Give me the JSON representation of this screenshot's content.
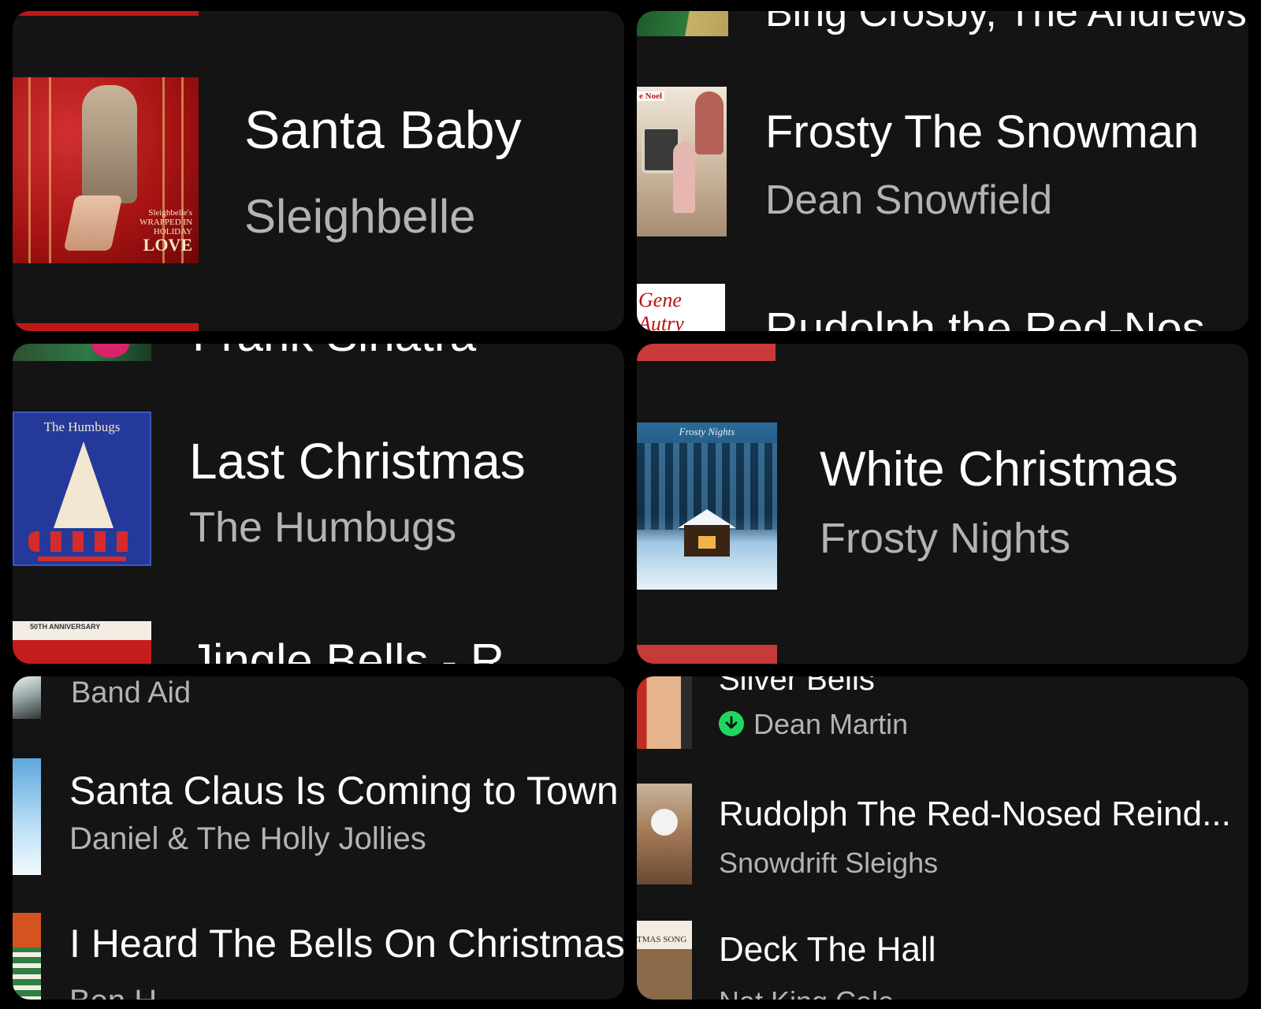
{
  "panel1": {
    "title": "Santa Baby",
    "artist": "Sleighbelle",
    "album_caption_small": "Sleighbelle's",
    "album_caption_line1": "WRAPPED IN",
    "album_caption_line2": "HOLIDAY",
    "album_caption_big": "LOVE"
  },
  "panel2": {
    "prev_artist": "Bing Crosby, The Andrews",
    "title": "Frosty The Snowman",
    "artist": "Dean Snowfield",
    "art_label": "e Noel",
    "next_art_label": "Gene Autry",
    "next_title": "Rudolph the Red-Nos"
  },
  "panel3": {
    "prev_artist": "Frank Sinatra",
    "title": "Last Christmas",
    "artist": "The Humbugs",
    "art_label": "The Humbugs",
    "next_art_label": "50TH ANNIVERSARY",
    "next_title": "Jingle Bells - R"
  },
  "panel4": {
    "title": "White Christmas",
    "artist": "Frosty Nights",
    "art_label": "Frosty Nights"
  },
  "panel5": {
    "prev_artist": "Band Aid",
    "title": "Santa Claus Is Coming to Town",
    "artist": "Daniel & The Holly Jollies",
    "next_title": "I Heard The Bells On Christmas ..",
    "next_artist": "Ben H"
  },
  "panel6": {
    "prev_title": "Silver Bells",
    "prev_artist": "Dean Martin",
    "downloaded_icon": "download-check-icon",
    "title": "Rudolph The Red-Nosed Reind...",
    "artist": "Snowdrift Sleighs",
    "next_title": "Deck The Hall",
    "next_artist": "Nat King Cole",
    "next_art_label": "TMAS SONG"
  },
  "colors": {
    "background": "#000000",
    "panel": "#141414",
    "title": "#ffffff",
    "subtitle": "#b3b3b3",
    "accent_green": "#1ed760"
  }
}
